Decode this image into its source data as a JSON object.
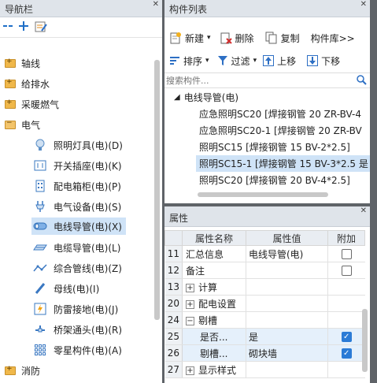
{
  "nav": {
    "title": "导航栏",
    "items": [
      {
        "label": "轴线",
        "type": "folder"
      },
      {
        "label": "给排水",
        "type": "folder"
      },
      {
        "label": "采暖燃气",
        "type": "folder"
      },
      {
        "label": "电气",
        "type": "folder-open"
      },
      {
        "label": "照明灯具(电)(D)",
        "icon": "lamp-icon"
      },
      {
        "label": "开关插座(电)(K)",
        "icon": "switch-socket-icon"
      },
      {
        "label": "配电箱柜(电)(P)",
        "icon": "distribution-box-icon"
      },
      {
        "label": "电气设备(电)(S)",
        "icon": "electrical-equipment-icon"
      },
      {
        "label": "电线导管(电)(X)",
        "icon": "wire-conduit-icon"
      },
      {
        "label": "电缆导管(电)(L)",
        "icon": "cable-conduit-icon"
      },
      {
        "label": "综合管线(电)(Z)",
        "icon": "combined-pipeline-icon"
      },
      {
        "label": "母线(电)(I)",
        "icon": "busbar-icon"
      },
      {
        "label": "防雷接地(电)(J)",
        "icon": "lightning-grounding-icon"
      },
      {
        "label": "桥架通头(电)(R)",
        "icon": "bridge-tee-icon"
      },
      {
        "label": "零星构件(电)(A)",
        "icon": "misc-component-icon"
      },
      {
        "label": "消防",
        "type": "folder"
      }
    ]
  },
  "complist": {
    "title": "构件列表",
    "toolbar1": {
      "new": "新建",
      "delete": "删除",
      "copy": "复制",
      "library": "构件库>>"
    },
    "toolbar2": {
      "sort": "排序",
      "filter": "过滤",
      "up": "上移",
      "down": "下移"
    },
    "search_placeholder": "搜索构件...",
    "root": "电线导管(电)",
    "rows": [
      "应急照明SC20 [焊接钢管 20 ZR-BV-4",
      "应急照明SC20-1 [焊接钢管 20 ZR-BV",
      "照明SC15 [焊接钢管 15 BV-2*2.5]",
      "照明SC15-1 [焊接钢管 15 BV-3*2.5 是",
      "照明SC20 [焊接钢管 20 BV-4*2.5]"
    ]
  },
  "props": {
    "title": "属性",
    "headers": {
      "name": "属性名称",
      "value": "属性值",
      "attach": "附加"
    },
    "rows": [
      {
        "num": "11",
        "name": "汇总信息",
        "value": "电线导管(电)",
        "check": "off"
      },
      {
        "num": "12",
        "name": "备注",
        "value": "",
        "check": "off"
      },
      {
        "num": "13",
        "name": "计算",
        "value": "",
        "toggle": "+"
      },
      {
        "num": "20",
        "name": "配电设置",
        "value": "",
        "toggle": "+"
      },
      {
        "num": "24",
        "name": "剔槽",
        "value": "",
        "toggle": "−"
      },
      {
        "num": "25",
        "name": "是否...",
        "value": "是",
        "check": "on",
        "indent": true
      },
      {
        "num": "26",
        "name": "剔槽...",
        "value": "砌块墙",
        "check": "on",
        "indent": true
      },
      {
        "num": "27",
        "name": "显示样式",
        "value": "",
        "toggle": "+"
      }
    ]
  }
}
